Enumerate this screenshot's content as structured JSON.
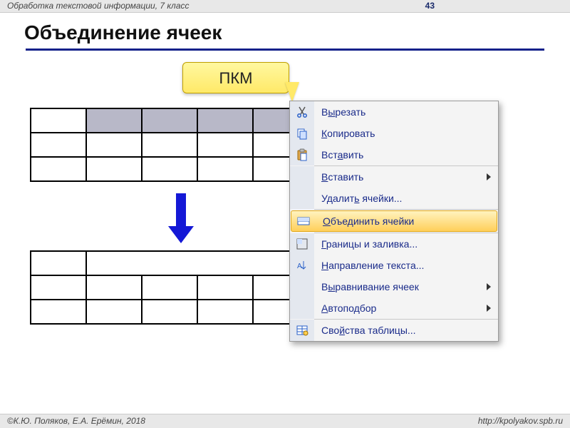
{
  "header": {
    "subject": "Обработка текстовой информации, 7 класс",
    "page_no": "43"
  },
  "title": "Объединение ячеек",
  "callout_label": "ПКМ",
  "context_menu": {
    "items": [
      {
        "label_pre": "В",
        "label_u": "ы",
        "label_post": "резать",
        "icon": "cut"
      },
      {
        "label_pre": "",
        "label_u": "К",
        "label_post": "опировать",
        "icon": "copy"
      },
      {
        "label_pre": "Вст",
        "label_u": "а",
        "label_post": "вить",
        "icon": "paste"
      }
    ],
    "items2": [
      {
        "label_pre": "",
        "label_u": "В",
        "label_post": "ставить",
        "submenu": true
      },
      {
        "label_pre": "Удалит",
        "label_u": "ь",
        "label_post": " ячейки..."
      }
    ],
    "highlight": {
      "label_pre": "",
      "label_u": "О",
      "label_post": "бъединить ячейки",
      "icon": "merge"
    },
    "items3": [
      {
        "label_pre": "",
        "label_u": "Г",
        "label_post": "раницы и заливка...",
        "icon": "border"
      },
      {
        "label_pre": "",
        "label_u": "Н",
        "label_post": "аправление текста...",
        "icon": "textdir"
      },
      {
        "label_pre": "В",
        "label_u": "ы",
        "label_post": "равнивание ячеек",
        "submenu": true
      },
      {
        "label_pre": "",
        "label_u": "А",
        "label_post": "втоподбор",
        "submenu": true
      }
    ],
    "items4": [
      {
        "label_pre": "Сво",
        "label_u": "й",
        "label_post": "ства таблицы...",
        "icon": "props"
      }
    ]
  },
  "footer": {
    "authors": "К.Ю. Поляков, Е.А. Ерёмин, 2018",
    "url": "http://kpolyakov.spb.ru"
  }
}
